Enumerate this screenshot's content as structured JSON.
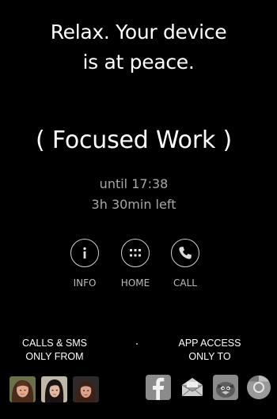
{
  "headline": {
    "line1": "Relax. Your device",
    "line2": "is at peace."
  },
  "mode": {
    "label": "( Focused Work )"
  },
  "timer": {
    "until": "until 17:38",
    "left": "3h 30min left"
  },
  "actions": [
    {
      "label": "INFO",
      "icon": "info-icon"
    },
    {
      "label": "HOME",
      "icon": "grid-icon"
    },
    {
      "label": "CALL",
      "icon": "phone-icon"
    }
  ],
  "calls": {
    "line1": "CALLS & SMS",
    "line2": "ONLY FROM"
  },
  "apps": {
    "line1": "APP ACCESS",
    "line2": "ONLY TO",
    "items": [
      {
        "icon": "facebook-icon"
      },
      {
        "icon": "mail-icon"
      },
      {
        "icon": "angry-birds-icon"
      },
      {
        "icon": "chrome-icon"
      }
    ]
  },
  "colors": {
    "accent": "#ffffff",
    "muted": "#a8a8a8",
    "facebook": "#3b5998"
  }
}
